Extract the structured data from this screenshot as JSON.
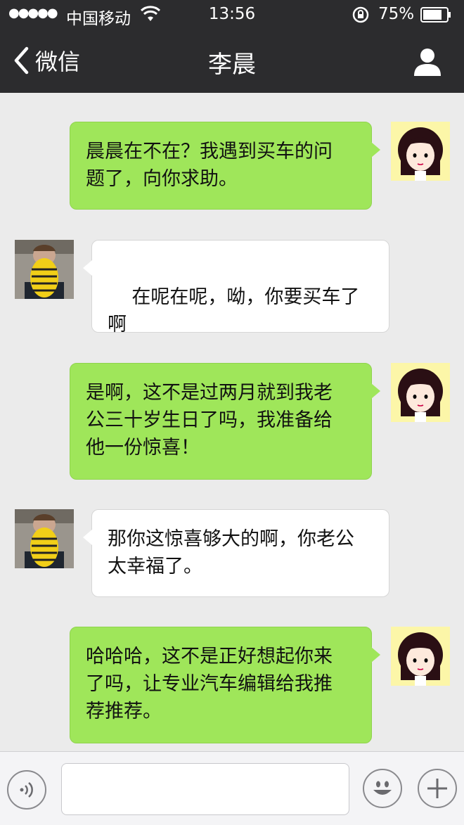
{
  "status_bar": {
    "signal": "●●●●●",
    "carrier": "中国移动",
    "time": "13:56",
    "battery_percent": "75%",
    "icons": [
      "wifi-icon",
      "orientation-lock-icon",
      "battery-icon"
    ]
  },
  "nav": {
    "back_label": "微信",
    "title": "李晨",
    "icons": [
      "chevron-left-icon",
      "profile-icon"
    ]
  },
  "messages": [
    {
      "direction": "out",
      "text": "晨晨在不在？我遇到买车的问\n题了，向你求助。"
    },
    {
      "direction": "in",
      "text": "在呢在呢，呦，你要买车了啊",
      "emoji": "blushing-face-icon"
    },
    {
      "direction": "out",
      "text": "是啊，这不是过两月就到我老\n公三十岁生日了吗，我准备给\n他一份惊喜！"
    },
    {
      "direction": "in",
      "text": "那你这惊喜够大的啊，你老公\n太幸福了。"
    },
    {
      "direction": "out",
      "text": "哈哈哈，这不是正好想起你来\n了吗，让专业汽车编辑给我推\n荐推荐。"
    }
  ],
  "input_bar": {
    "placeholder": "",
    "icons": [
      "voice-icon",
      "emoji-icon",
      "plus-icon"
    ]
  },
  "colors": {
    "header_bg": "#2c2c2e",
    "chat_bg": "#ebebeb",
    "outgoing_bubble": "#9fe65a",
    "incoming_bubble": "#ffffff"
  }
}
